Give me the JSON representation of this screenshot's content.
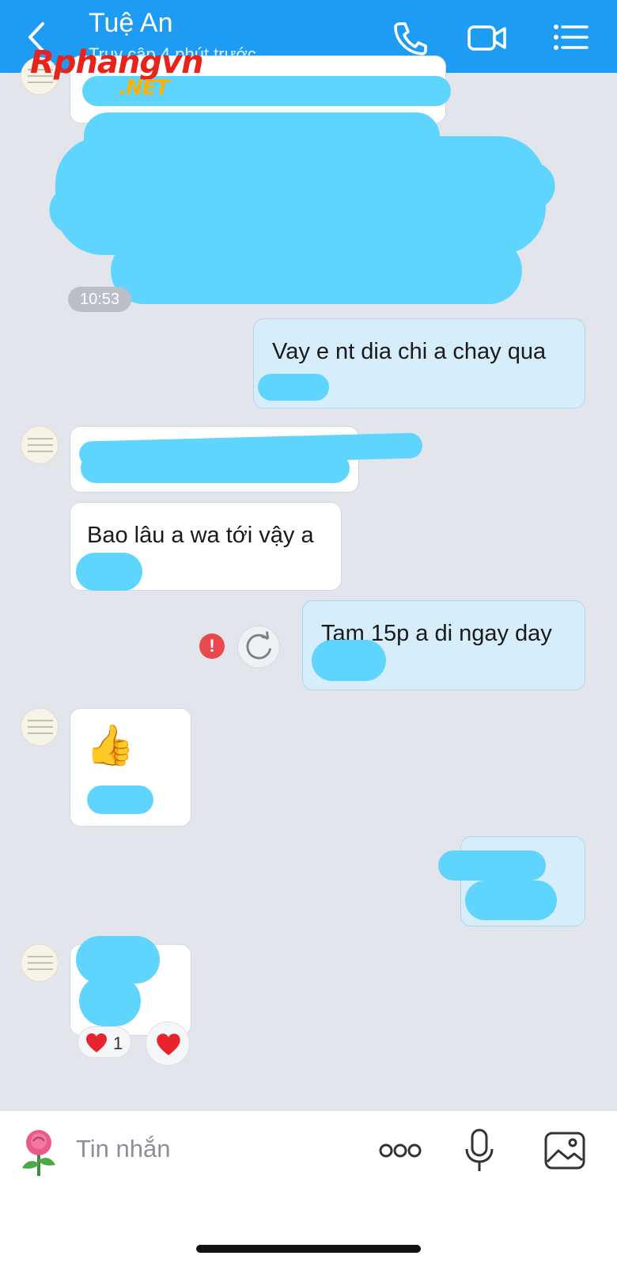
{
  "header": {
    "title": "Tuệ An",
    "subtitle": "Truy cập 4 phút trước",
    "watermark": "Rphangvn",
    "watermark_net": ".NET"
  },
  "messages": [
    {
      "id": "m1",
      "direction": "incoming",
      "text": "",
      "redacted": true
    },
    {
      "id": "m2",
      "direction": "incoming",
      "text": "",
      "redacted": true,
      "time": "10:53"
    },
    {
      "id": "m3",
      "direction": "outgoing",
      "text": "Vay e nt dia chi a chay qua"
    },
    {
      "id": "m4",
      "direction": "incoming",
      "text": "",
      "redacted": true
    },
    {
      "id": "m5",
      "direction": "incoming",
      "text": "Bao lâu a wa tới vậy a"
    },
    {
      "id": "m6",
      "direction": "outgoing",
      "text": "Tam 15p a di ngay day",
      "status": "failed"
    },
    {
      "id": "m7",
      "direction": "incoming",
      "text": "👍"
    },
    {
      "id": "m8",
      "direction": "outgoing",
      "text": "",
      "redacted": true
    },
    {
      "id": "m9",
      "direction": "incoming",
      "text": "",
      "redacted": true,
      "reaction_count": "1"
    }
  ],
  "error_mark": "!",
  "input": {
    "placeholder": "Tin nhắn"
  },
  "icons": {
    "back": "chevron-left-icon",
    "call": "phone-icon",
    "video": "video-camera-icon",
    "menu": "list-menu-icon",
    "error": "error-icon",
    "retry": "retry-icon",
    "heart": "heart-icon",
    "sticker": "rose-sticker-icon",
    "more": "more-dots-icon",
    "mic": "microphone-icon",
    "image": "image-icon"
  },
  "colors": {
    "header_bg": "#1e9bf3",
    "chat_bg": "#e3e5ec",
    "outgoing_bubble": "#d6edfb",
    "incoming_bubble": "#ffffff",
    "redaction": "#5fd4fd",
    "error": "#e8484e",
    "heart": "#e8232e"
  }
}
